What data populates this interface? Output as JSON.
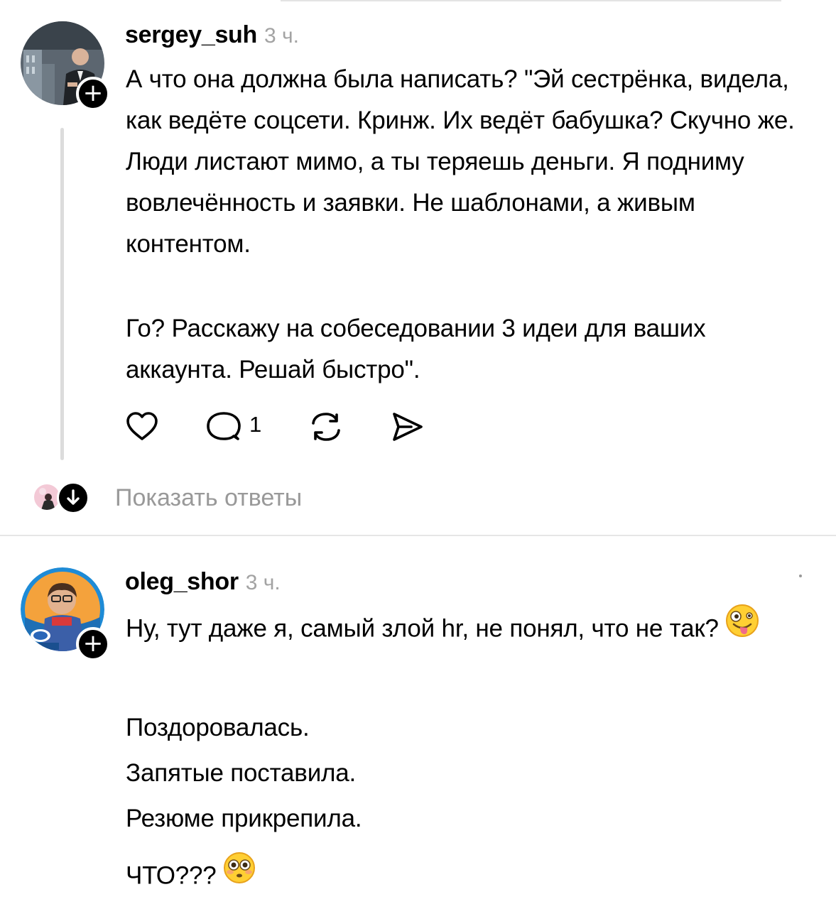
{
  "comments": [
    {
      "username": "sergey_suh",
      "time": "3 ч.",
      "paragraph1": "А что она должна была написать? \"Эй сестрёнка, видела, как ведёте соцсети. Кринж. Их ведёт бабушка? Скучно же. Люди листают мимо, а ты теряешь деньги. Я подниму вовлечённость и заявки. Не шаблонами, а живым контентом.",
      "paragraph2": "Го? Расскажу на собеседовании 3 идеи для ваших аккаунта.  Решай быстро\".",
      "reply_count": "1",
      "show_replies_label": "Показать ответы"
    },
    {
      "username": "oleg_shor",
      "time": "3 ч.",
      "paragraph1": "Ну, тут даже я, самый злой hr, не понял, что не так?",
      "lines": [
        "Поздоровалась.",
        "Запятые поставила.",
        "Резюме прикрепила."
      ],
      "last_line": "ЧТО???"
    }
  ],
  "icons": {
    "plus": "plus-icon",
    "like": "heart-icon",
    "reply": "comment-bubble-icon",
    "repost": "repost-icon",
    "share": "send-icon",
    "expand": "arrow-down-icon",
    "emoji1": "zany-face-emoji",
    "emoji2": "flushed-face-emoji"
  },
  "colors": {
    "text": "#000000",
    "muted": "#999999",
    "time": "#a3a3a3",
    "divider": "#e6e6e6"
  }
}
